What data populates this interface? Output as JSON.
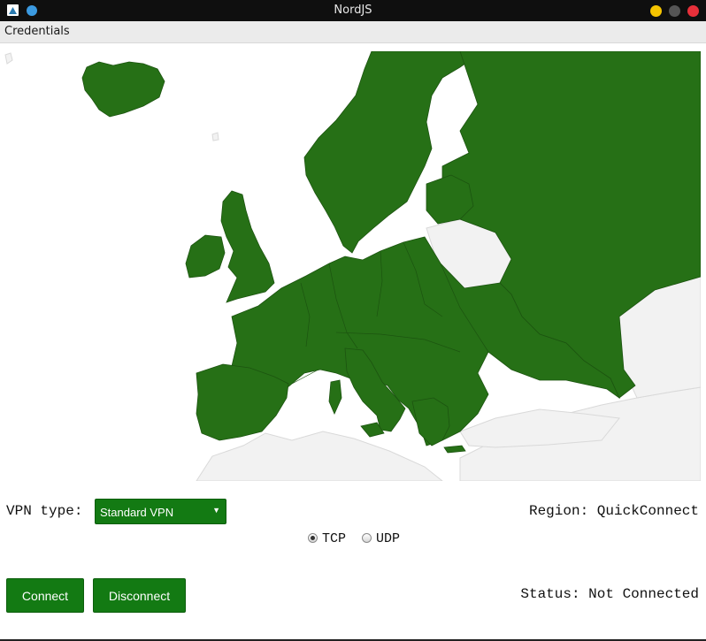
{
  "window": {
    "title": "NordJS"
  },
  "menu": {
    "items": [
      "Credentials"
    ]
  },
  "map": {
    "highlight_color": "#267016",
    "base_color": "#f2f2f2",
    "border_color": "#d9d9d9"
  },
  "vpn": {
    "type_label": "VPN type:",
    "type_value": "Standard VPN",
    "region_text": "Region: QuickConnect",
    "protocol_options": [
      "TCP",
      "UDP"
    ],
    "protocol_selected": "TCP"
  },
  "buttons": {
    "connect": "Connect",
    "disconnect": "Disconnect"
  },
  "status": {
    "text": "Status: Not Connected"
  },
  "colors": {
    "accent": "#137a13",
    "titlebar": "#0f0f0f"
  }
}
